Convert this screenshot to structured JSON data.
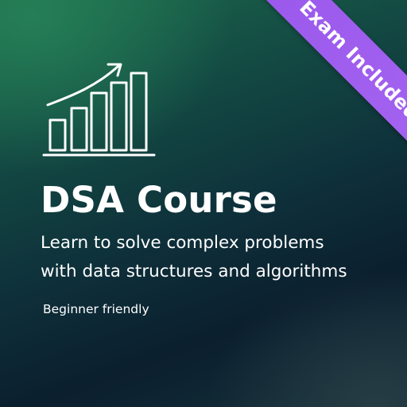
{
  "card": {
    "icon": "bar-chart-growth-icon",
    "title": "DSA Course",
    "subtitle_line1": "Learn to solve complex problems",
    "subtitle_line2": "with data structures and algorithms",
    "note": "Beginner friendly",
    "ribbon_label": "Exam Included"
  },
  "colors": {
    "ribbon": "#a463f0",
    "text": "#ffffff",
    "background_top": "#1d6b4c",
    "background_bottom": "#0b1f2e"
  }
}
